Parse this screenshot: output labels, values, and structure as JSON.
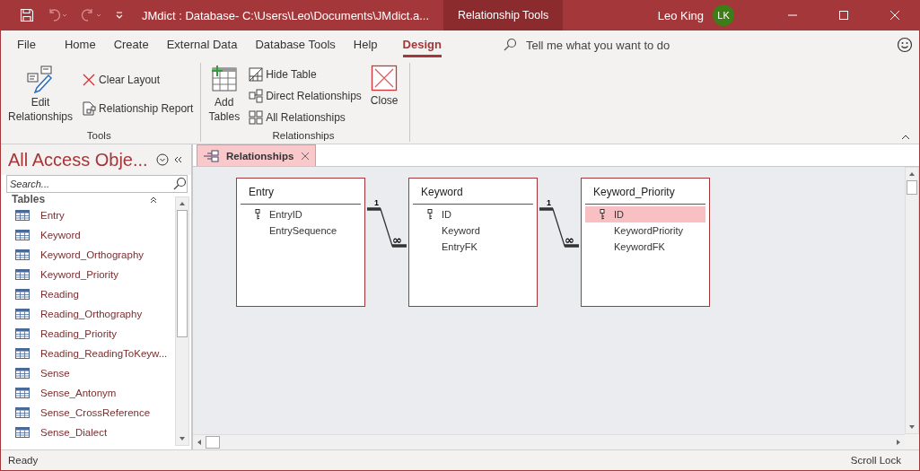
{
  "window": {
    "title": "JMdict : Database- C:\\Users\\Leo\\Documents\\JMdict.a...",
    "context_tab": "Relationship Tools",
    "user_name": "Leo King",
    "user_initials": "LK"
  },
  "menu_tabs": [
    {
      "label": "File",
      "selected": false
    },
    {
      "label": "Home",
      "selected": false
    },
    {
      "label": "Create",
      "selected": false
    },
    {
      "label": "External Data",
      "selected": false
    },
    {
      "label": "Database Tools",
      "selected": false
    },
    {
      "label": "Help",
      "selected": false
    },
    {
      "label": "Design",
      "selected": true
    }
  ],
  "tell_me": {
    "placeholder": "Tell me what you want to do"
  },
  "ribbon_groups": [
    {
      "label": "Tools",
      "commands": [
        {
          "label": "Edit\nRelationships",
          "kind": "large"
        },
        {
          "label": "Clear Layout",
          "kind": "small"
        },
        {
          "label": "Relationship Report",
          "kind": "small"
        }
      ]
    },
    {
      "label": "Relationships",
      "commands": [
        {
          "label": "Add\nTables",
          "kind": "large"
        },
        {
          "label": "Hide Table",
          "kind": "small"
        },
        {
          "label": "Direct Relationships",
          "kind": "small"
        },
        {
          "label": "All Relationships",
          "kind": "small"
        },
        {
          "label": "Close",
          "kind": "large"
        }
      ]
    }
  ],
  "navigation_pane": {
    "title": "All Access Obje...",
    "search": {
      "placeholder": "Search..."
    },
    "group": "Tables",
    "items": [
      "Entry",
      "Keyword",
      "Keyword_Orthography",
      "Keyword_Priority",
      "Reading",
      "Reading_Orthography",
      "Reading_Priority",
      "Reading_ReadingToKeyw...",
      "Sense",
      "Sense_Antonym",
      "Sense_CrossReference",
      "Sense_Dialect"
    ]
  },
  "document_tab": {
    "label": "Relationships"
  },
  "tables": [
    {
      "name": "Entry",
      "fields": [
        {
          "name": "EntryID",
          "kind": "primary",
          "selected": false
        },
        {
          "name": "EntrySequence",
          "kind": "plain",
          "selected": false
        }
      ]
    },
    {
      "name": "Keyword",
      "fields": [
        {
          "name": "ID",
          "kind": "primary",
          "selected": false
        },
        {
          "name": "Keyword",
          "kind": "plain",
          "selected": false
        },
        {
          "name": "EntryFK",
          "kind": "foreign",
          "selected": false
        }
      ]
    },
    {
      "name": "Keyword_Priority",
      "fields": [
        {
          "name": "ID",
          "kind": "primary",
          "selected": true
        },
        {
          "name": "KeywordPriority",
          "kind": "plain",
          "selected": false
        },
        {
          "name": "KeywordFK",
          "kind": "foreign",
          "selected": false
        }
      ]
    }
  ],
  "relationships": [
    {
      "one_label": "1",
      "many_label": "∞"
    },
    {
      "one_label": "1",
      "many_label": "∞"
    }
  ],
  "status_bar": {
    "left": "Ready",
    "right": "Scroll Lock"
  }
}
